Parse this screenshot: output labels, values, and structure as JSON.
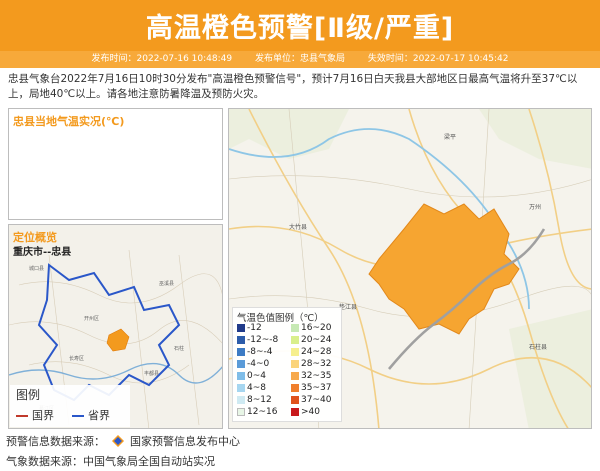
{
  "header": {
    "title": "高温橙色预警[Ⅱ级/严重]",
    "issue_time": "发布时间：2022-07-16 10:48:49",
    "issuer": "发布单位：忠县气象局",
    "expire_time": "失效时间：2022-07-17 10:45:42",
    "color": "#f39a1e"
  },
  "description": "忠县气象台2022年7月16日10时30分发布\"高温橙色预警信号\"，预计7月16日白天我县大部地区日最高气温将升至37℃以上，局地40℃以上。请各地注意防暑降温及预防火灾。",
  "temp_panel": {
    "title": "忠县当地气温实况(℃)"
  },
  "location_panel": {
    "title": "定位概览",
    "place": "重庆市--忠县",
    "legend_title": "图例",
    "legend_items": [
      {
        "label": "国界",
        "color": "#c0392b"
      },
      {
        "label": "省界",
        "color": "#2a57c9"
      }
    ]
  },
  "temp_legend": {
    "title": "气温色值图例（℃）",
    "items": [
      {
        "label": "-12",
        "color": "#213b8a"
      },
      {
        "label": "-12~-8",
        "color": "#2c5caa"
      },
      {
        "label": "-8~-4",
        "color": "#3d7bc4"
      },
      {
        "label": "-4~0",
        "color": "#5a9bd8"
      },
      {
        "label": "0~4",
        "color": "#7fbde8"
      },
      {
        "label": "4~8",
        "color": "#a6d6f0"
      },
      {
        "label": "8~12",
        "color": "#cfeaf2"
      },
      {
        "label": "12~16",
        "color": "#e8f6e6"
      },
      {
        "label": "16~20",
        "color": "#c7e9b4"
      },
      {
        "label": "20~24",
        "color": "#d9ef8b"
      },
      {
        "label": "24~28",
        "color": "#f6ef8e"
      },
      {
        "label": "28~32",
        "color": "#fbd47a"
      },
      {
        "label": "32~35",
        "color": "#f7a94b"
      },
      {
        "label": "35~37",
        "color": "#f07f2c"
      },
      {
        "label": "37~40",
        "color": "#e0521c"
      },
      {
        "label": ">40",
        "color": "#c8191b"
      }
    ]
  },
  "footer": {
    "source1_prefix": "预警信息数据来源：",
    "source1_name": "国家预警信息发布中心",
    "source2": "气象数据来源：中国气象局全国自动站实况"
  }
}
